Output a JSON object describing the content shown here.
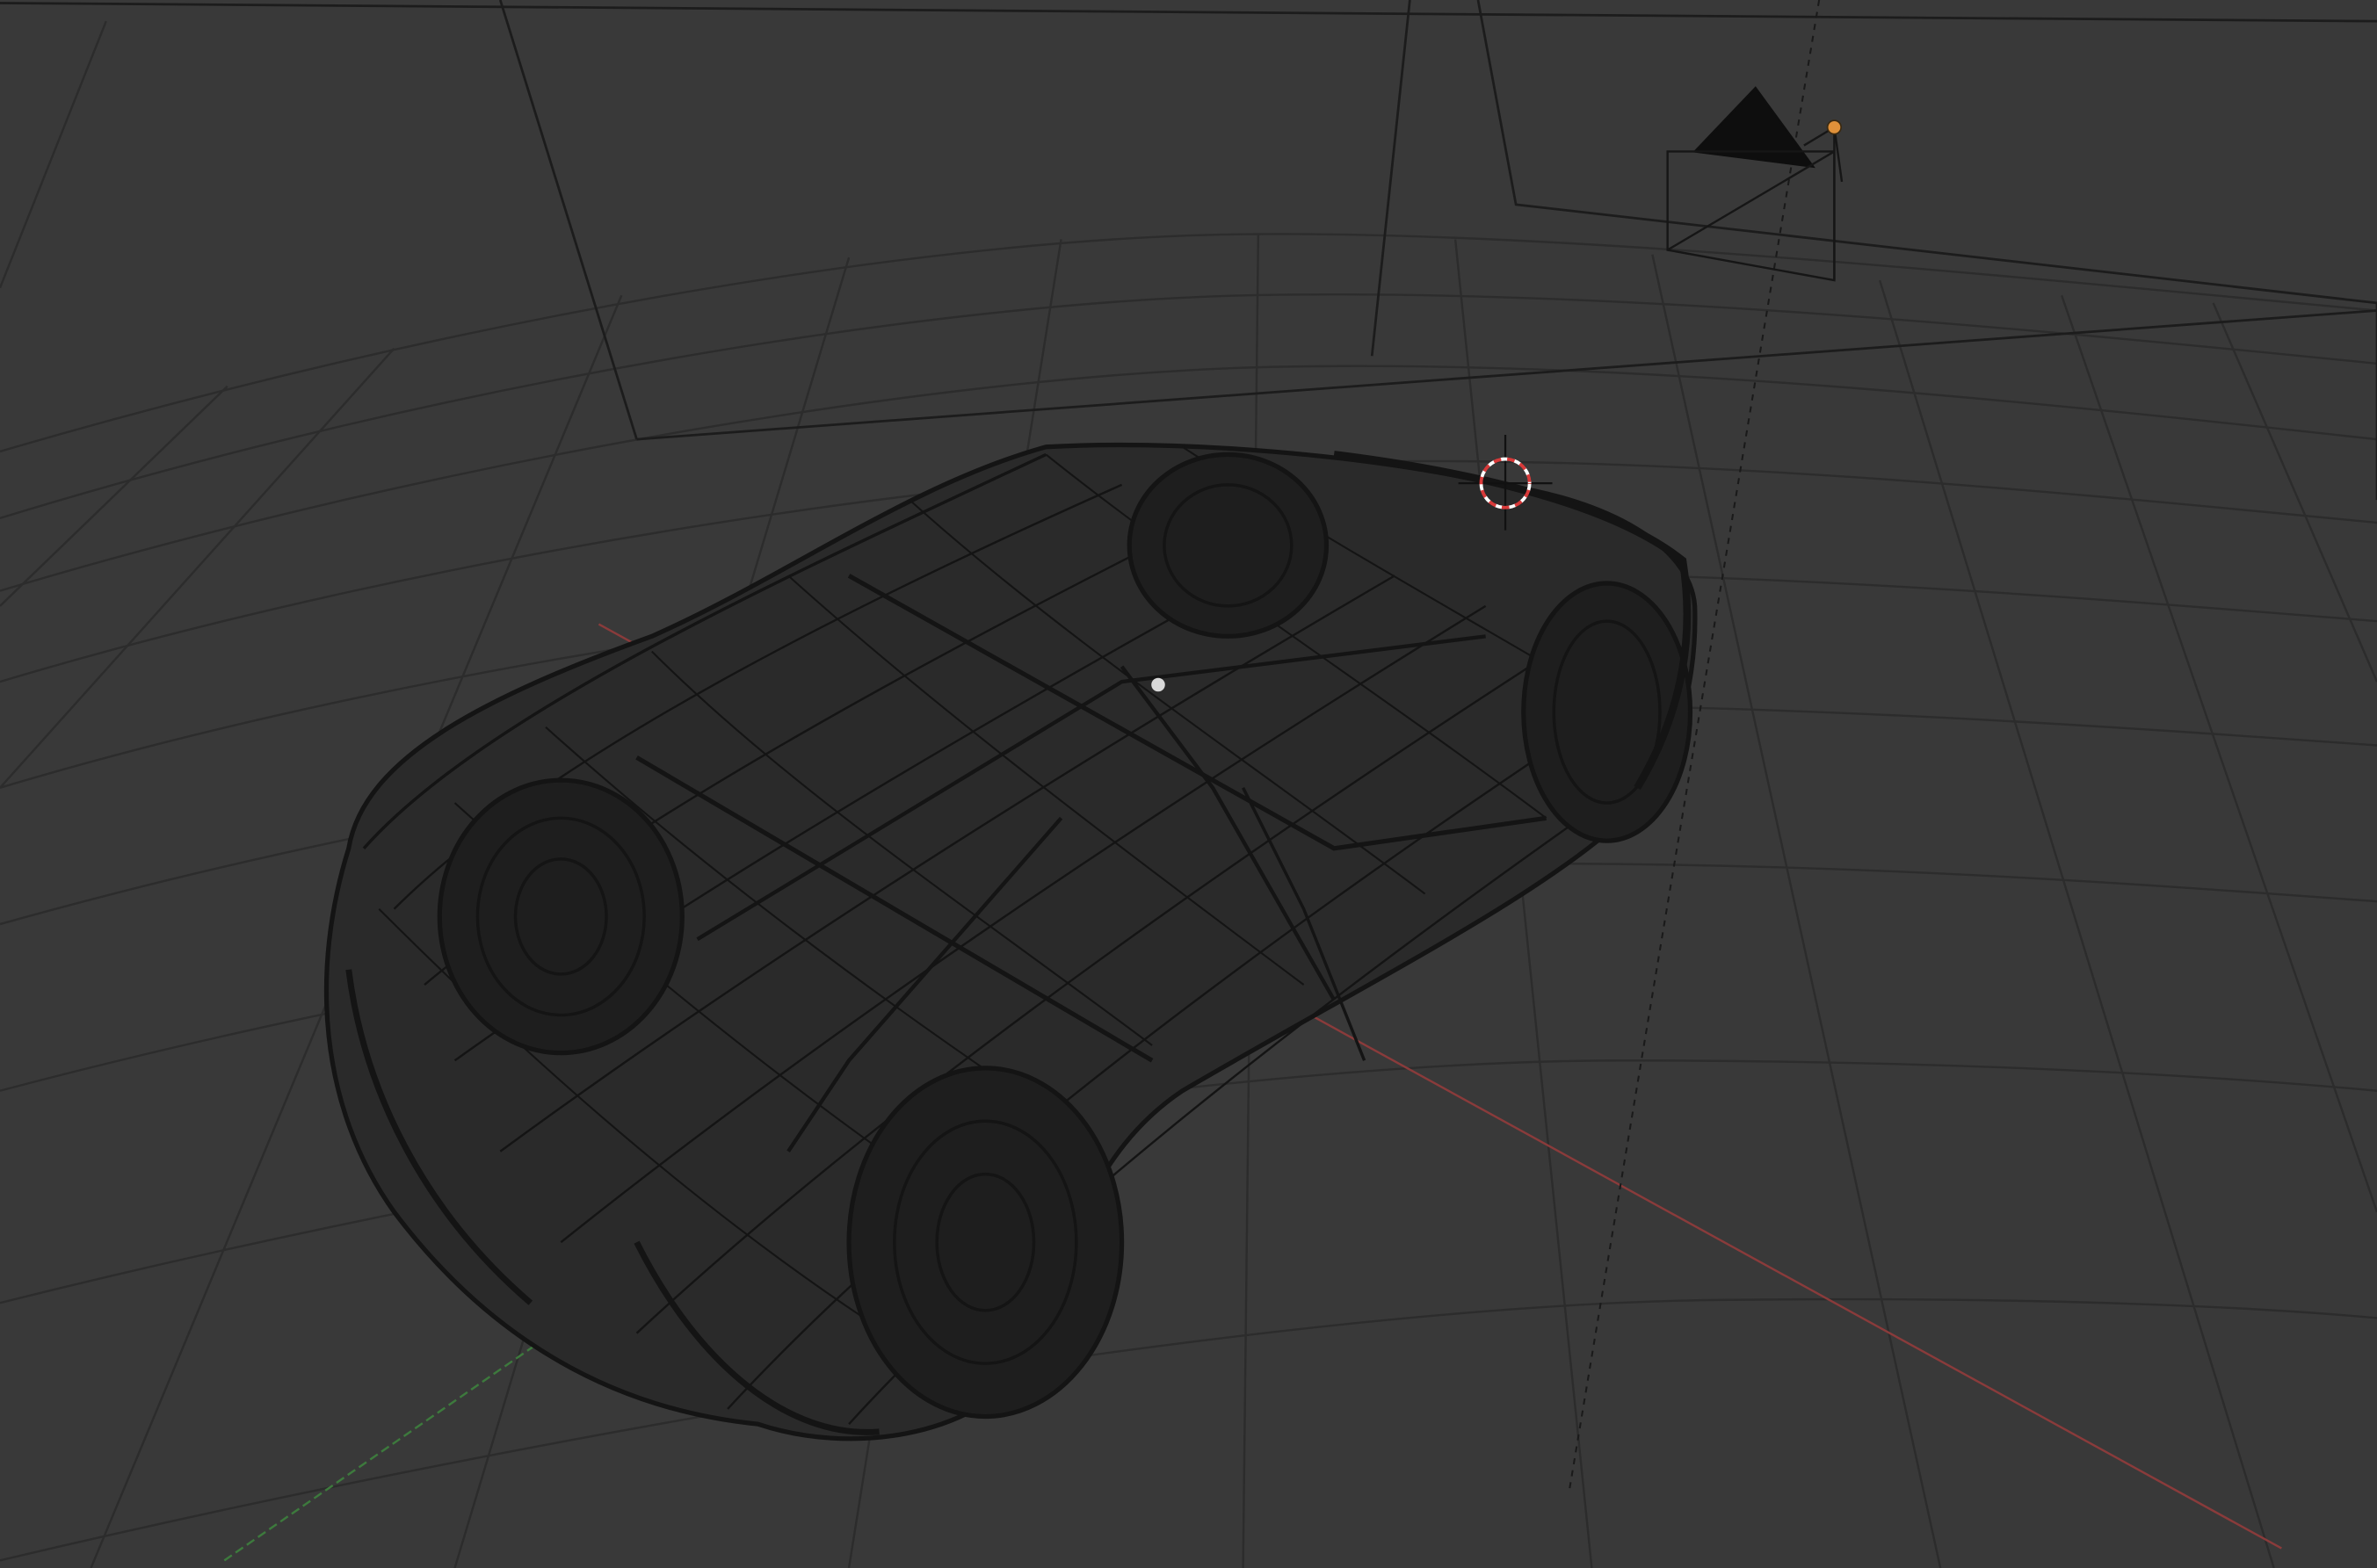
{
  "viewport": {
    "shading": "wireframe",
    "background": "#393939",
    "objects": [
      "grid-floor",
      "x-axis",
      "y-axis",
      "car-mesh",
      "camera",
      "lamp",
      "3d-cursor",
      "origin-point"
    ]
  },
  "colors": {
    "grid_line": "#2c2c2c",
    "wire": "#141414",
    "x_axis": "#8a3b3b",
    "y_axis": "#3d7a3d",
    "cursor_red": "#d83a3a",
    "cursor_white": "#ffffff",
    "lamp_selected": "#e0913a",
    "origin": "#d9d9d9"
  },
  "icons": {
    "camera": "camera-icon",
    "lamp": "lamp-icon",
    "cursor": "3d-cursor-icon"
  }
}
